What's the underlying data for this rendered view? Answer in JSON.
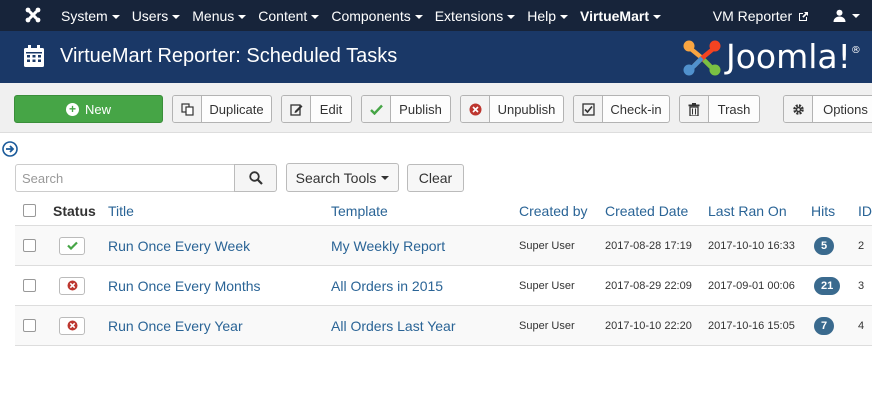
{
  "navbar": {
    "menu": [
      {
        "label": "System",
        "caret": true
      },
      {
        "label": "Users",
        "caret": true
      },
      {
        "label": "Menus",
        "caret": true
      },
      {
        "label": "Content",
        "caret": true
      },
      {
        "label": "Components",
        "caret": true
      },
      {
        "label": "Extensions",
        "caret": true
      },
      {
        "label": "Help",
        "caret": true
      },
      {
        "label": "VirtueMart",
        "caret": true,
        "bold": true
      }
    ],
    "site_link": "VM Reporter",
    "site_link_icon": "external-link-icon",
    "user_icon": "user-icon"
  },
  "header": {
    "title": "VirtueMart Reporter: Scheduled Tasks",
    "icon": "calendar-icon",
    "brand": "Joomla!",
    "brand_mark": "®"
  },
  "toolbar": {
    "new": "New",
    "duplicate": "Duplicate",
    "edit": "Edit",
    "publish": "Publish",
    "unpublish": "Unpublish",
    "checkin": "Check-in",
    "trash": "Trash",
    "options": "Options"
  },
  "filters": {
    "search_placeholder": "Search",
    "search_tools": "Search Tools",
    "clear": "Clear"
  },
  "table": {
    "columns": {
      "status": "Status",
      "title": "Title",
      "template": "Template",
      "created_by": "Created by",
      "created_date": "Created Date",
      "last_ran_on": "Last Ran On",
      "hits": "Hits",
      "id": "ID"
    },
    "rows": [
      {
        "published": true,
        "title": "Run Once Every Week",
        "template": "My Weekly Report",
        "created_by": "Super User",
        "created_date": "2017-08-28 17:19",
        "last_ran_on": "2017-10-10 16:33",
        "hits": "5",
        "id": "2"
      },
      {
        "published": false,
        "title": "Run Once Every Months",
        "template": "All Orders in 2015",
        "created_by": "Super User",
        "created_date": "2017-08-29 22:09",
        "last_ran_on": "2017-09-01 00:06",
        "hits": "21",
        "id": "3"
      },
      {
        "published": false,
        "title": "Run Once Every Year",
        "template": "All Orders Last Year",
        "created_by": "Super User",
        "created_date": "2017-10-10 22:20",
        "last_ran_on": "2017-10-16 15:05",
        "hits": "7",
        "id": "4"
      }
    ]
  },
  "colors": {
    "navbar": "#17243a",
    "header": "#1a3867",
    "new_button": "#46a546",
    "link": "#2a6496",
    "badge": "#3a6a8e",
    "published": "#46a546",
    "unpublished": "#bd362f"
  }
}
